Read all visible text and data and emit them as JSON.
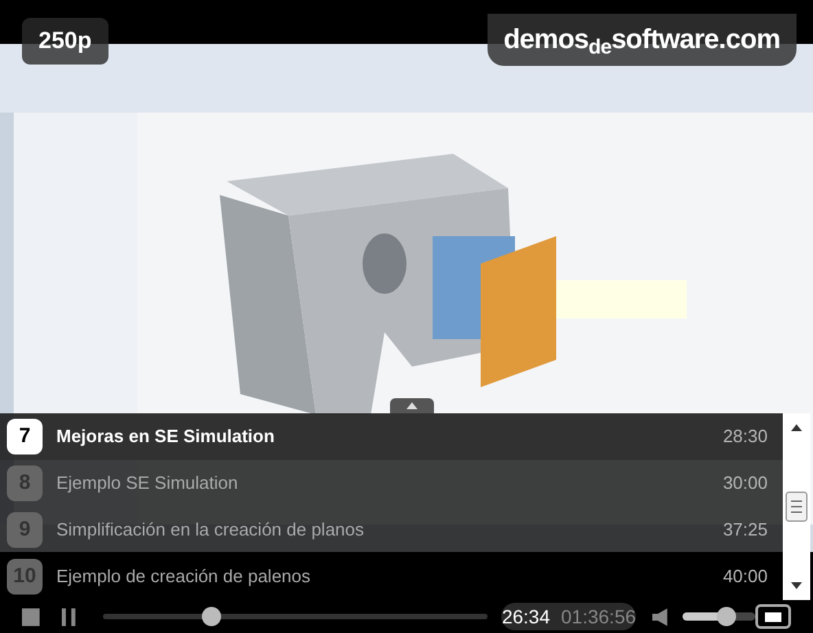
{
  "quality_badge": "250p",
  "logo": "demos$_{de}$software.com",
  "playlist": [
    {
      "number": "7",
      "title": "Mejoras en SE Simulation",
      "duration": "28:30",
      "selected": true
    },
    {
      "number": "8",
      "title": "Ejemplo SE Simulation",
      "duration": "30:00",
      "selected": false
    },
    {
      "number": "9",
      "title": "Simplificación en la creación de planos",
      "duration": "37:25",
      "selected": false
    },
    {
      "number": "10",
      "title": "Ejemplo de creación de palenos",
      "duration": "40:00",
      "selected": false
    }
  ],
  "controls": {
    "progress": {
      "level": 0.28
    },
    "current_time": "26:34",
    "total_time": "01:36:56",
    "volume": {
      "level": 0.6
    }
  }
}
